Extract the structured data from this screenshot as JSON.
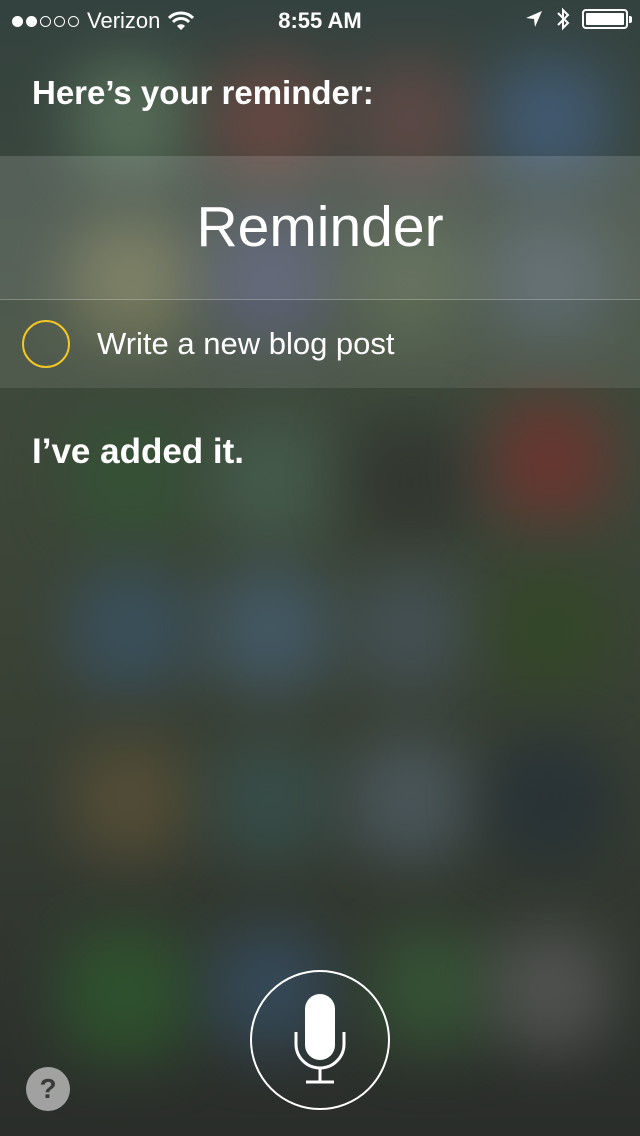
{
  "status_bar": {
    "signal_filled": 2,
    "signal_total": 5,
    "carrier": "Verizon",
    "time": "8:55 AM",
    "icons": [
      "wifi-icon",
      "location-arrow-icon",
      "bluetooth-icon",
      "battery-icon"
    ],
    "battery_level": 1.0
  },
  "siri": {
    "prompt": "Here’s your reminder:",
    "response": "I’ve added it."
  },
  "reminder_card": {
    "title": "Reminder",
    "items": [
      {
        "text": "Write a new blog post",
        "checkbox_color": "#f2c624"
      }
    ]
  },
  "controls": {
    "microphone_icon": "microphone-icon",
    "help_label": "?"
  }
}
